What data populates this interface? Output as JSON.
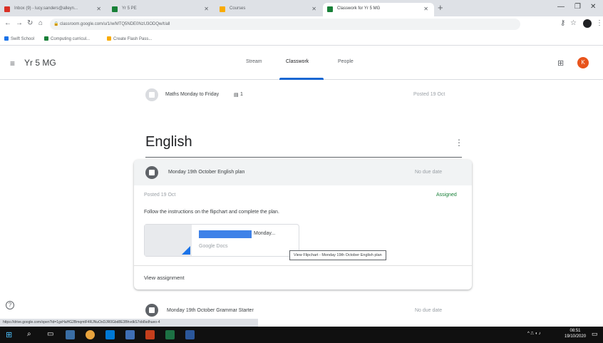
{
  "browser": {
    "tabs": [
      {
        "title": "Inbox (9) - lucy.sanders@alleyn...",
        "active": false,
        "color": "#d93025"
      },
      {
        "title": "Yr 5 PE",
        "active": false,
        "color": "#188038"
      },
      {
        "title": "Courses",
        "active": false,
        "color": "#f9ab00"
      },
      {
        "title": "Classwork for Yr 5 MG",
        "active": true,
        "color": "#188038"
      }
    ],
    "new_tab": "+",
    "url": "classroom.google.com/u/1/w/MTQ5NDE0NzU3ODQw/t/all",
    "bookmarks": [
      {
        "label": "Swift School",
        "color": "#1a73e8"
      },
      {
        "label": "Computing curricul...",
        "color": "#188038"
      },
      {
        "label": "Create Flash Pass...",
        "color": "#f9ab00"
      }
    ]
  },
  "header": {
    "menu_icon": "≡",
    "class_name": "Yr 5 MG",
    "tabs": [
      {
        "label": "Stream",
        "active": false
      },
      {
        "label": "Classwork",
        "active": true
      },
      {
        "label": "People",
        "active": false
      }
    ],
    "apps_icon": "⊞",
    "avatar_initial": "K"
  },
  "prior_item": {
    "title": "Maths Monday to Friday",
    "count": "1",
    "posted": "Posted 19 Oct"
  },
  "topic": {
    "title": "English",
    "menu_icon": "⋮"
  },
  "assignment": {
    "title": "Monday 19th October English plan",
    "due": "No due date",
    "posted": "Posted 19 Oct",
    "status": "Assigned",
    "instructions": "Follow the instructions on the flipchart and complete the plan.",
    "attachment": {
      "title": "Monday...",
      "type": "Google Docs"
    },
    "tooltip": "View Flipchart - Monday 19th October English plan",
    "view_link": "View assignment"
  },
  "next_item": {
    "title": "Monday 19th October Grammar Starter",
    "due": "No due date"
  },
  "help_icon": "?",
  "status_url": "https://drive.google.com/open?id=1gxHaHG2BmqmtF4RJNuOxDJR0Gbd8E3BhvdkS7ob8sdhueo-4",
  "taskbar": {
    "time": "08:51",
    "date": "19/10/2020"
  }
}
